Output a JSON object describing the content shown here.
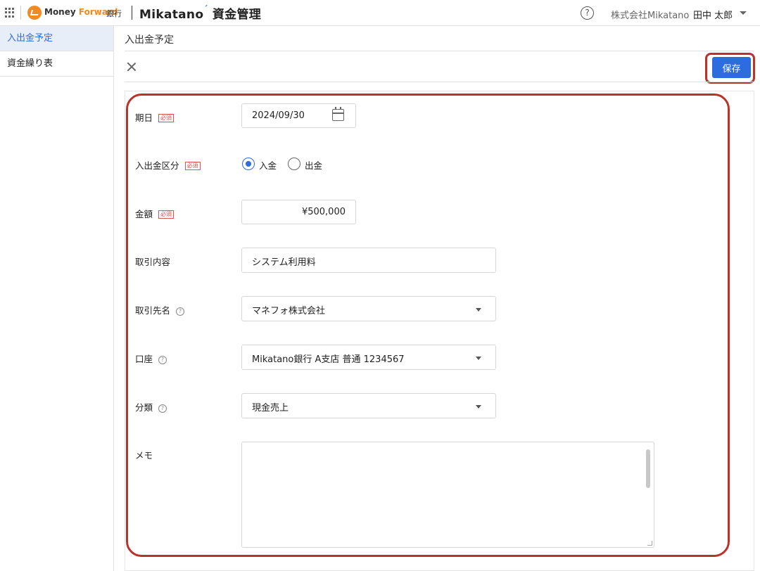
{
  "header": {
    "brand_money": "Money ",
    "brand_forward": "Forward",
    "brand_bank": "銀行",
    "product_name": "Mikatano",
    "product_suffix": "資金管理",
    "help_icon": "?",
    "company": "株式会社Mikatano",
    "user": "田中 太郎"
  },
  "sidebar": {
    "items": [
      {
        "label": "入出金予定",
        "active": true
      },
      {
        "label": "資金繰り表",
        "active": false
      }
    ]
  },
  "page": {
    "title": "入出金予定",
    "save_label": "保存"
  },
  "form": {
    "required_badge": "必須",
    "help_badge": "?",
    "date": {
      "label": "期日",
      "value": "2024/09/30"
    },
    "type": {
      "label": "入出金区分",
      "options": [
        "入金",
        "出金"
      ],
      "selected": "入金"
    },
    "amount": {
      "label": "金額",
      "value": "¥500,000"
    },
    "description": {
      "label": "取引内容",
      "value": "システム利用料"
    },
    "partner": {
      "label": "取引先名",
      "value": "マネフォ株式会社"
    },
    "account": {
      "label": "口座",
      "value": "Mikatano銀行 A支店 普通 1234567"
    },
    "category": {
      "label": "分類",
      "value": "現金売上"
    },
    "memo": {
      "label": "メモ",
      "value": ""
    }
  },
  "colors": {
    "accent": "#2d6cdf",
    "brand_orange": "#f08a24",
    "highlight": "#b8332a",
    "required": "#d9534f"
  }
}
